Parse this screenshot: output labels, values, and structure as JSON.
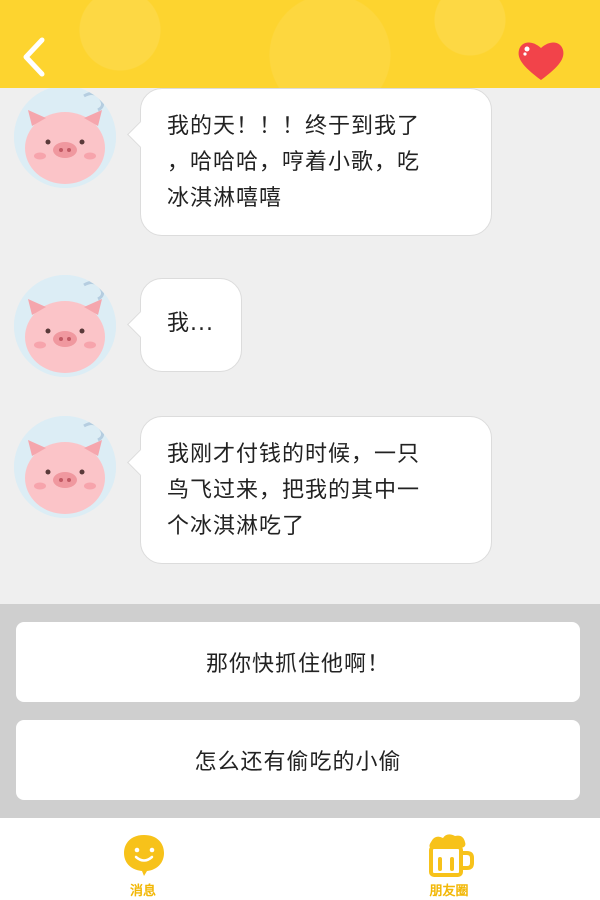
{
  "header": {
    "back_icon": "chevron-left-icon",
    "favorite_icon": "heart-icon",
    "background_color": "#fdd42f",
    "heart_color": "#f2434a"
  },
  "messages": [
    {
      "lines": [
        "我的天！！！终于到我了",
        "，哈哈哈，哼着小歌，吃",
        "冰淇淋嘻嘻"
      ]
    },
    {
      "lines": [
        "我..."
      ]
    },
    {
      "lines": [
        "我刚才付钱的时候，一只",
        "鸟飞过来，把我的其中一",
        "个冰淇淋吃了"
      ]
    }
  ],
  "options": [
    {
      "label": "那你快抓住他啊！"
    },
    {
      "label": "怎么还有偷吃的小偷"
    }
  ],
  "tabbar": {
    "accent_color": "#f2b705",
    "tabs": [
      {
        "label": "消息",
        "icon": "smiley-chat-icon"
      },
      {
        "label": "朋友圈",
        "icon": "beer-mug-icon"
      }
    ]
  }
}
